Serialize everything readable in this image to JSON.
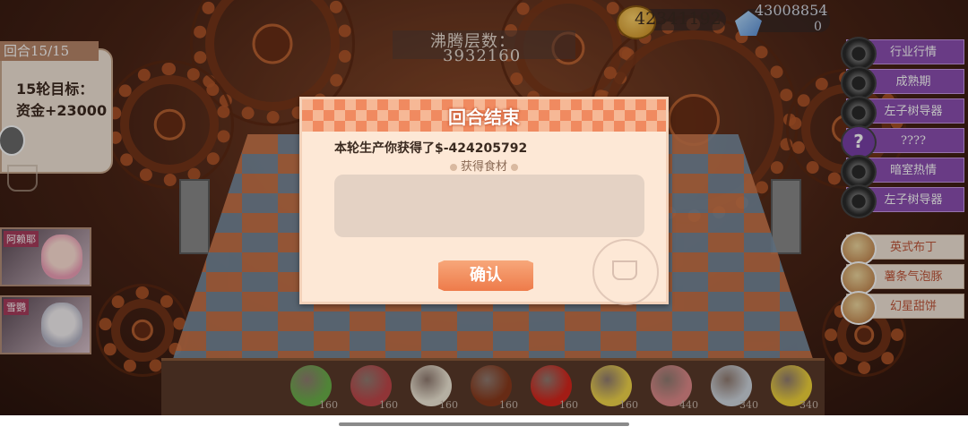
{
  "hud": {
    "round_tab": "回合15/15",
    "goal_title": "15轮目标：",
    "goal_value": "资金+23000",
    "boil_label": "沸腾层数：",
    "boil_value": "3932160",
    "coins": "42341192",
    "gems_line1": "43008854",
    "gems_line2": "0"
  },
  "right_menu": {
    "items": [
      {
        "label": "行业行情",
        "icon": "gear-icon"
      },
      {
        "label": "成熟期",
        "icon": "gear-icon"
      },
      {
        "label": "左子树导器",
        "icon": "gear-icon"
      },
      {
        "label": "????",
        "icon": "question-icon",
        "icon_text": "?"
      },
      {
        "label": "暗室热情",
        "icon": "gear-icon"
      },
      {
        "label": "左子树导器",
        "icon": "gear-icon"
      }
    ],
    "dishes": [
      {
        "label": "英式布丁",
        "icon": "dish-icon"
      },
      {
        "label": "薯条气泡豚",
        "icon": "dish-icon"
      },
      {
        "label": "幻星甜饼",
        "icon": "dish-icon"
      }
    ]
  },
  "characters": [
    {
      "name": "阿赖耶"
    },
    {
      "name": "雪鹦"
    }
  ],
  "ingredients": [
    {
      "name": "lettuce-icon",
      "count": "160",
      "color": "#6bb04a"
    },
    {
      "name": "meat-icon",
      "count": "160",
      "color": "#c0474a"
    },
    {
      "name": "tofu-icon",
      "count": "160",
      "color": "#f2ead8"
    },
    {
      "name": "star-anise-icon",
      "count": "160",
      "color": "#8a3a1c"
    },
    {
      "name": "chili-icon",
      "count": "160",
      "color": "#d8261c"
    },
    {
      "name": "pufferfish-icon",
      "count": "160",
      "color": "#f2d64a"
    },
    {
      "name": "bacon-icon",
      "count": "440",
      "color": "#e08a8a"
    },
    {
      "name": "fish-fillet-icon",
      "count": "340",
      "color": "#cfd6de"
    },
    {
      "name": "lemon-icon",
      "count": "340",
      "color": "#f2d43a"
    }
  ],
  "dialog": {
    "title": "回合结束",
    "result_text": "本轮生产你获得了$-424205792",
    "section_label": "获得食材",
    "confirm_label": "确认"
  },
  "colors": {
    "dialog_bg": "#fde8d6",
    "header_orange": "#f08a60",
    "confirm_orange": "#ee7b4a",
    "menu_purple": "#8c4fb2"
  }
}
